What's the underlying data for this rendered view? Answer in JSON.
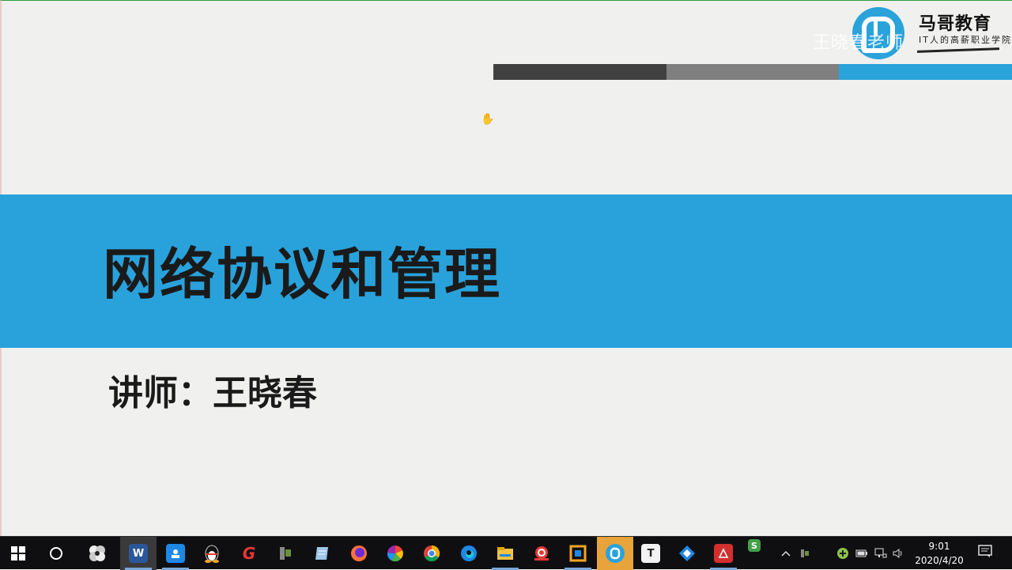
{
  "slide": {
    "title": "网络协议和管理",
    "lecturer": "讲师：王晓春",
    "brand_name": "马哥教育",
    "brand_slogan": "IT人的高薪职业学院",
    "watermark": "王晓春老师",
    "colors": {
      "band": "#29a2dc",
      "bar_dark": "#404040",
      "bar_gray": "#7f7f7f",
      "bar_blue": "#2aa3db"
    },
    "cursor": "hand-cursor"
  },
  "taskbar": {
    "apps": [
      {
        "name": "start-button",
        "icon": "windows-icon"
      },
      {
        "name": "cortana-search-button",
        "icon": "circle-icon"
      },
      {
        "name": "app-pinwheel",
        "icon": "pinwheel-icon"
      },
      {
        "name": "app-word",
        "icon": "word-icon",
        "glyph": "W"
      },
      {
        "name": "app-photo-viewer",
        "icon": "photo-icon"
      },
      {
        "name": "app-qq",
        "icon": "penguin-icon"
      },
      {
        "name": "app-red-g",
        "icon": "g-icon",
        "glyph": "G"
      },
      {
        "name": "app-flashlight",
        "icon": "flashlight-icon"
      },
      {
        "name": "app-notes",
        "icon": "notepad-icon"
      },
      {
        "name": "app-firefox",
        "icon": "firefox-icon"
      },
      {
        "name": "app-color-wheel",
        "icon": "color-wheel-icon"
      },
      {
        "name": "app-chrome",
        "icon": "chrome-icon"
      },
      {
        "name": "app-edge",
        "icon": "edge-icon"
      },
      {
        "name": "app-file-explorer",
        "icon": "folder-icon"
      },
      {
        "name": "app-snail",
        "icon": "snail-icon"
      },
      {
        "name": "app-virtualbox",
        "icon": "virtualbox-icon"
      },
      {
        "name": "app-magedu-player",
        "icon": "magedu-icon"
      },
      {
        "name": "app-typora",
        "icon": "typora-icon",
        "glyph": "T"
      },
      {
        "name": "app-teamviewer",
        "icon": "teamviewer-icon"
      },
      {
        "name": "app-acrobat",
        "icon": "pdf-icon"
      },
      {
        "name": "app-wps",
        "icon": "wps-icon",
        "glyph": "S"
      }
    ],
    "tray": {
      "time": "9:01",
      "date": "2020/4/20"
    }
  }
}
